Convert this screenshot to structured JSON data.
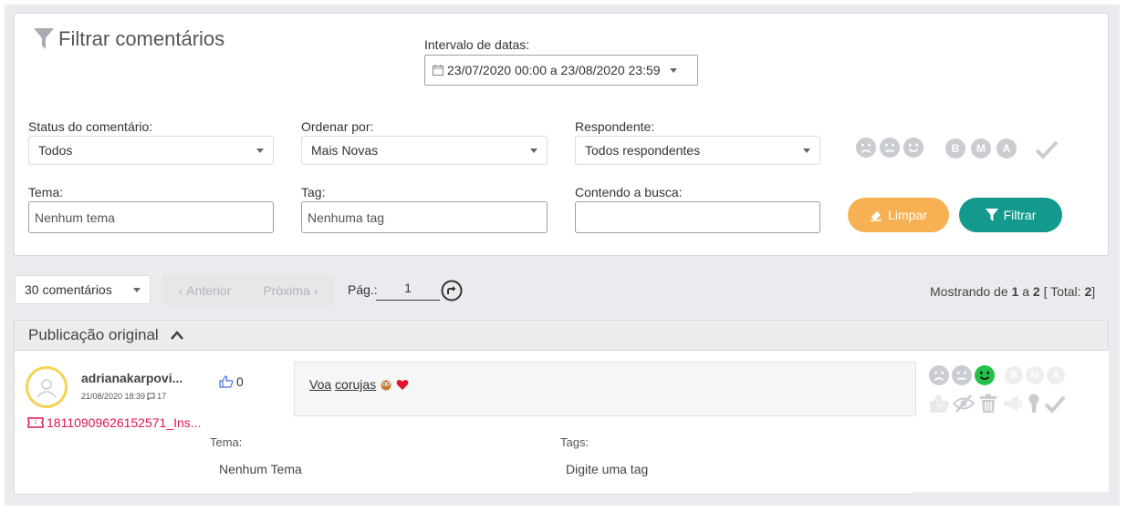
{
  "filter": {
    "title": "Filtrar comentários",
    "date_label": "Intervalo de datas:",
    "date_value": "23/07/2020 00:00 a 23/08/2020 23:59",
    "status_label": "Status do comentário:",
    "status_value": "Todos",
    "order_label": "Ordenar por:",
    "order_value": "Mais Novas",
    "respondent_label": "Respondente:",
    "respondent_value": "Todos respondentes",
    "tema_label": "Tema:",
    "tema_placeholder": "Nenhum tema",
    "tag_label": "Tag:",
    "tag_placeholder": "Nenhuma tag",
    "search_label": "Contendo a busca:",
    "search_value": "",
    "sentiment_letters": [
      "B",
      "M",
      "A"
    ],
    "clear_label": "Limpar",
    "filter_label": "Filtrar"
  },
  "pagination": {
    "per_page": "30 comentários",
    "prev": "Anterior",
    "next": "Próxima",
    "page_label": "Pág.:",
    "page_value": "1",
    "showing_prefix": "Mostrando de",
    "from": "1",
    "a": "a",
    "to": "2",
    "total_prefix": "[ Total:",
    "total": "2",
    "total_suffix": "]"
  },
  "publication": {
    "header": "Publicação original"
  },
  "comment": {
    "author": "adrianakarpovi...",
    "date": "21/08/2020 18:39",
    "replies": "17",
    "likes": "0",
    "ticket": "18110909626152571_Ins...",
    "text_word1": "Voa",
    "text_word2": "corujas",
    "tema_label": "Tema:",
    "tema_value": "Nenhum Tema",
    "tags_label": "Tags:",
    "tags_value": "Digite uma tag",
    "letters": [
      "B",
      "M",
      "A"
    ]
  },
  "colors": {
    "accent_teal": "#139a8c",
    "accent_orange": "#f8b152",
    "ticket_red": "#e0174f",
    "happy_green": "#23c04a"
  }
}
